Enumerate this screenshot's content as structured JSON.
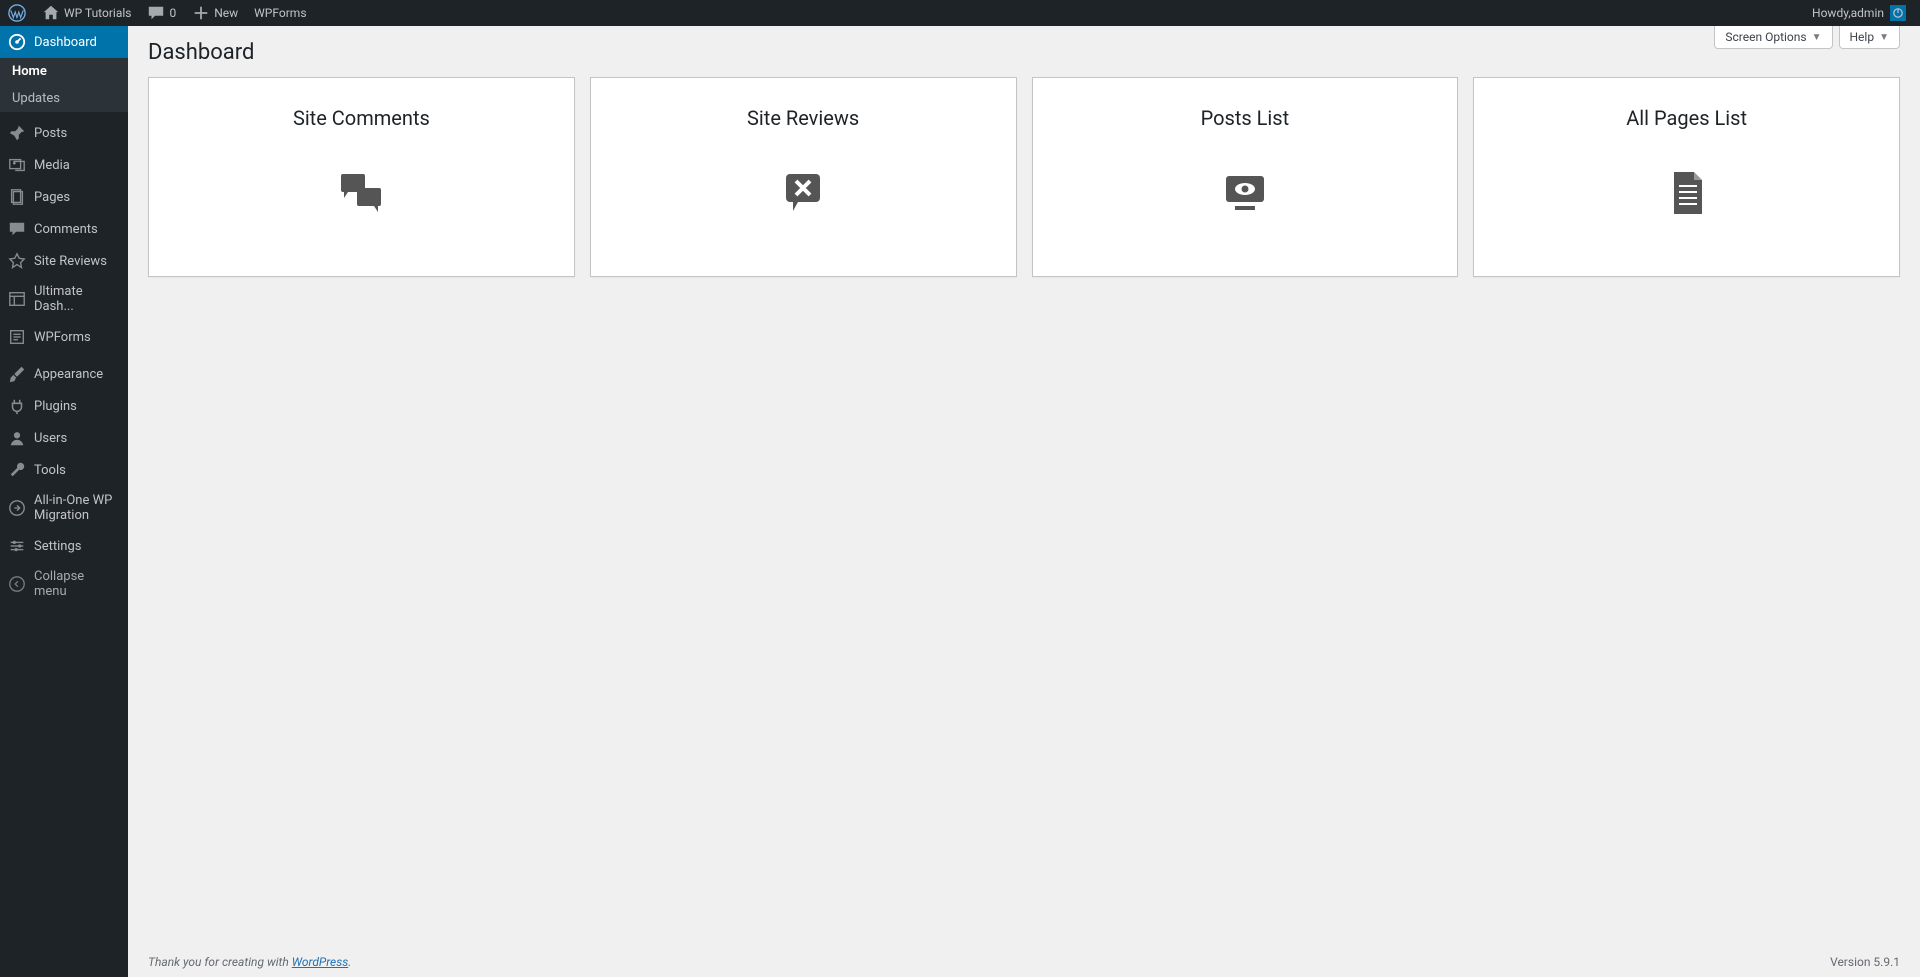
{
  "adminbar": {
    "site_name": "WP Tutorials",
    "comments_count": "0",
    "new_label": "New",
    "wpforms_label": "WPForms",
    "howdy_prefix": "Howdy, ",
    "user_name": "admin"
  },
  "sidebar": {
    "items": [
      {
        "label": "Dashboard",
        "icon": "dashboard",
        "current": true
      },
      {
        "label": "Posts",
        "icon": "pin"
      },
      {
        "label": "Media",
        "icon": "media"
      },
      {
        "label": "Pages",
        "icon": "pages"
      },
      {
        "label": "Comments",
        "icon": "comment"
      },
      {
        "label": "Site Reviews",
        "icon": "star"
      },
      {
        "label": "Ultimate Dash...",
        "icon": "layout"
      },
      {
        "label": "WPForms",
        "icon": "form"
      },
      {
        "label": "Appearance",
        "icon": "brush"
      },
      {
        "label": "Plugins",
        "icon": "plug"
      },
      {
        "label": "Users",
        "icon": "user"
      },
      {
        "label": "Tools",
        "icon": "wrench"
      },
      {
        "label": "All-in-One WP Migration",
        "icon": "migrate"
      },
      {
        "label": "Settings",
        "icon": "sliders"
      },
      {
        "label": "Collapse menu",
        "icon": "collapse"
      }
    ],
    "submenu": {
      "items": [
        {
          "label": "Home",
          "current": true
        },
        {
          "label": "Updates",
          "current": false
        }
      ]
    }
  },
  "screen_meta": {
    "screen_options": "Screen Options",
    "help": "Help"
  },
  "page": {
    "title": "Dashboard"
  },
  "widgets": [
    {
      "title": "Site Comments",
      "icon": "comments"
    },
    {
      "title": "Site Reviews",
      "icon": "review-x"
    },
    {
      "title": "Posts List",
      "icon": "eye-monitor"
    },
    {
      "title": "All Pages List",
      "icon": "doc"
    }
  ],
  "footer": {
    "thanks_prefix": "Thank you for creating with ",
    "wp_link": "WordPress",
    "thanks_suffix": ".",
    "version": "Version 5.9.1"
  }
}
